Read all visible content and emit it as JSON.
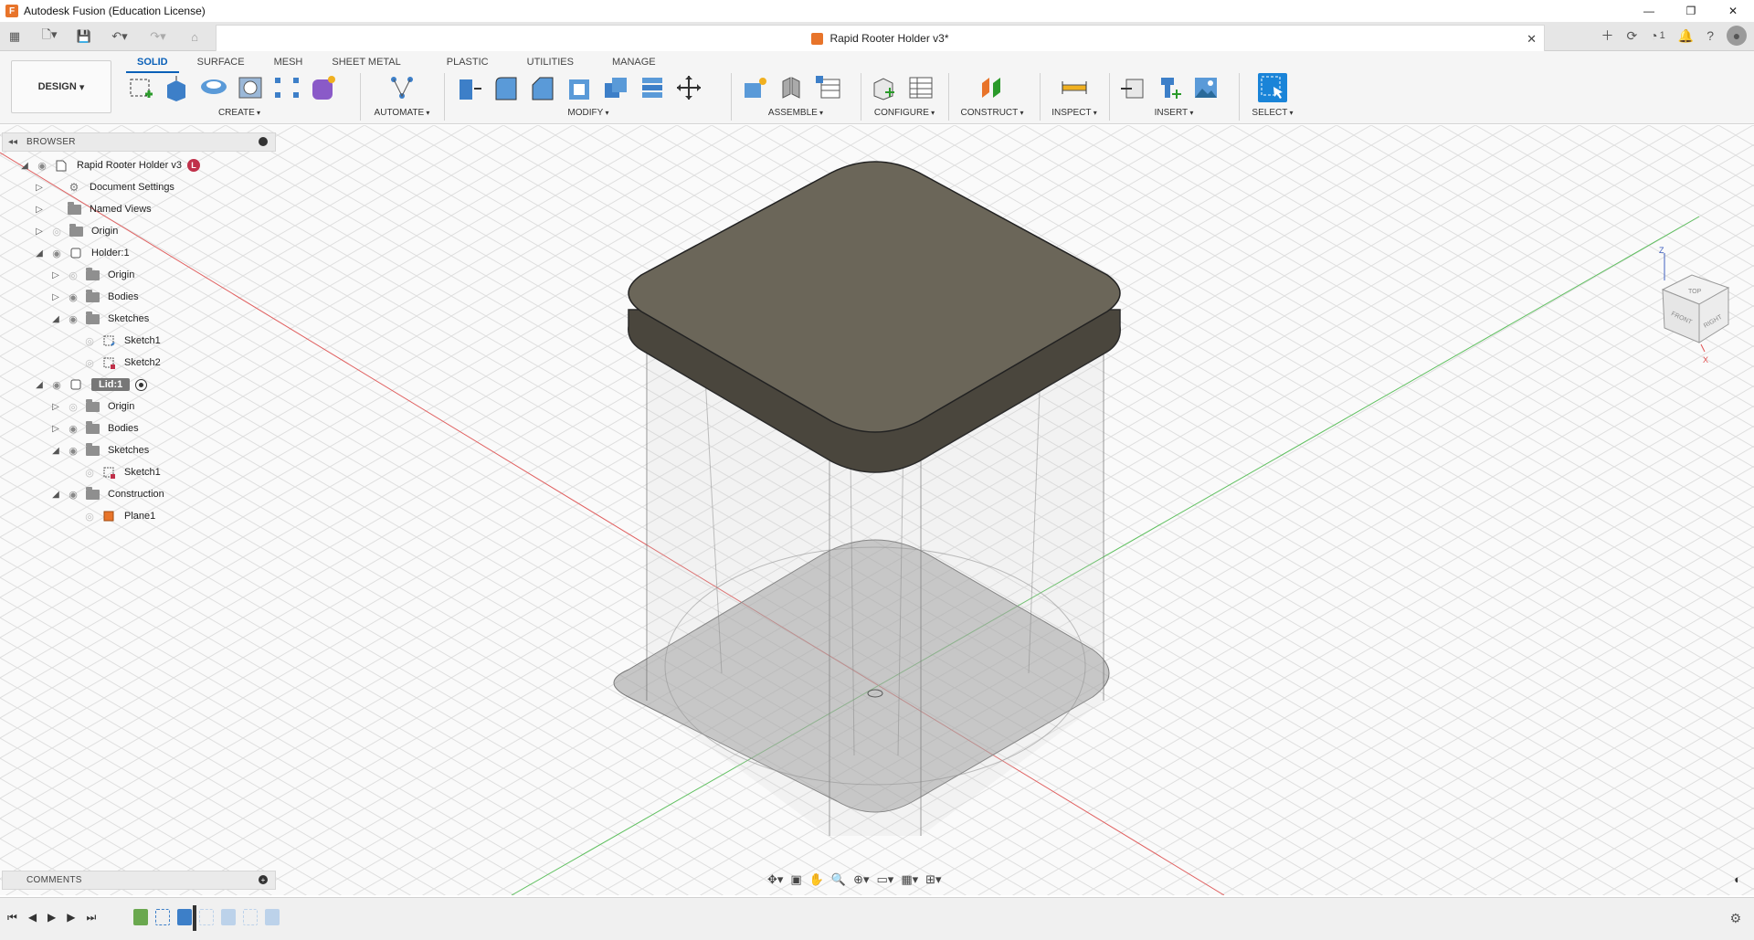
{
  "window": {
    "title": "Autodesk Fusion (Education License)"
  },
  "document": {
    "tab_title": "Rapid Rooter Holder v3*",
    "jobs_count": "1"
  },
  "toolbar": {
    "design_label": "DESIGN",
    "workspace_tabs": [
      "SOLID",
      "SURFACE",
      "MESH",
      "SHEET METAL",
      "PLASTIC",
      "UTILITIES",
      "MANAGE"
    ],
    "groups": [
      "CREATE",
      "AUTOMATE",
      "MODIFY",
      "ASSEMBLE",
      "CONFIGURE",
      "CONSTRUCT",
      "INSPECT",
      "INSERT",
      "SELECT"
    ]
  },
  "browser": {
    "title": "BROWSER",
    "root": "Rapid Rooter Holder v3",
    "root_badge": "L",
    "items": [
      "Document Settings",
      "Named Views",
      "Origin",
      "Holder:1",
      "Origin",
      "Bodies",
      "Sketches",
      "Sketch1",
      "Sketch2",
      "Lid:1",
      "Origin",
      "Bodies",
      "Sketches",
      "Sketch1",
      "Construction",
      "Plane1"
    ]
  },
  "viewcube": {
    "top": "TOP",
    "front": "FRONT",
    "right": "RIGHT",
    "axis_x": "X",
    "axis_z": "Z"
  },
  "comments": {
    "title": "COMMENTS"
  },
  "colors": {
    "accent": "#0a60b8",
    "fusion_orange": "#e8742a",
    "lid": "#6b6659",
    "x_axis": "#e05050",
    "y_axis": "#50c050"
  }
}
